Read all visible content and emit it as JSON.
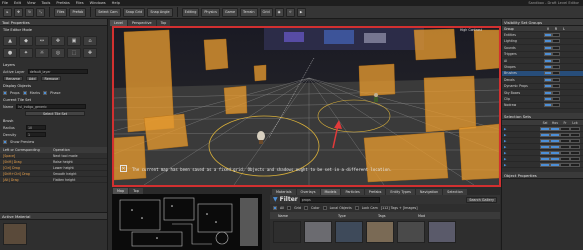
{
  "menubar": {
    "items": [
      "File",
      "Edit",
      "View",
      "Tools",
      "Prefabs",
      "Files",
      "Windows",
      "Help"
    ],
    "title": "Sandbox - Draft Level Editor"
  },
  "toolbar": {
    "labels": [
      "Files",
      "Prefab",
      "Select Cam",
      "Snap Grid",
      "Snap Angle",
      "Editing",
      "Physics",
      "Game",
      "Terrain",
      "Grid"
    ]
  },
  "leftpanel": {
    "title": "Tool Properties",
    "tool_title": "Tile Editor Mode",
    "tool_icons": [
      "▲",
      "◆",
      "↔",
      "✥",
      "▣",
      "⌂",
      "●",
      "✦",
      "☼",
      "◎",
      "⬚",
      "✚"
    ],
    "layers_label": "Layers",
    "active_layer_label": "Active Layer",
    "active_layer_value": "default_layer",
    "layer_buttons": [
      "Rename",
      "Add",
      "Remove"
    ],
    "display_label": "Display Objects",
    "display_opts": [
      "Props",
      "Marks",
      "Phase"
    ],
    "current_tile_label": "Current Tile Set",
    "name_label": "Name",
    "name_value": "lvl_indigo_generic",
    "select_btn": "Select Tile Set",
    "brush_label": "Brush",
    "radius_label": "Radius",
    "radius_value": "10",
    "density_label": "Density",
    "density_value": "1",
    "show_preview_label": "Show Preview",
    "shortcuts": {
      "col1": "Left or Corresponding",
      "col2": "Operation",
      "rows": [
        {
          "k": "[Space]",
          "v": "Next tool mode"
        },
        {
          "k": "[Shift] Drag",
          "v": "Raise height"
        },
        {
          "k": "[Ctrl] Drag",
          "v": "Lower height"
        },
        {
          "k": "[Shift+Ctrl] Drag",
          "v": "Smooth height"
        },
        {
          "k": "[Alt] Drag",
          "v": "Flatten height"
        }
      ]
    },
    "bottom_title": "Active Material"
  },
  "viewport": {
    "tabs": [
      "Level",
      "Perspective",
      "Top"
    ],
    "corner_label": "High Contrast",
    "hint_text": "The current map has been saved as a fixed grid. Objects and shadows ought to be set in a different location."
  },
  "minimap": {
    "tabs": [
      "Map",
      "Top"
    ]
  },
  "browser": {
    "tabs": [
      "Materials",
      "Overlays",
      "Models",
      "Particles",
      "Prefabs",
      "Entity Types",
      "Navigation",
      "Selection"
    ],
    "filter_title": "Filter",
    "search_value": "props",
    "opts": [
      "All",
      "Grid",
      "Color",
      "Local Objects",
      "Lock Cam",
      "Use Map"
    ],
    "count_label": "[112] Tags + [Images]",
    "search_btn": "Search Gallery",
    "columns": [
      "Name",
      "Type",
      "Tags",
      "Mod"
    ]
  },
  "rightpanel": {
    "title": "Visibility Set Groups",
    "group_header": [
      "Group",
      "V",
      "R",
      "L"
    ],
    "groups": [
      "Entities",
      "Lighting",
      "Sounds",
      "Triggers",
      "AI",
      "Shapes",
      "Brushes",
      "Decals",
      "Dynamic Props",
      "Sky Boxes",
      "Clip",
      "Nodraw"
    ],
    "selection_title": "Selection Sets",
    "sel_header": [
      "Sel",
      "Hov",
      "Fr",
      "Lck"
    ],
    "sel_rows": 7,
    "props_title": "Object Properties"
  },
  "colors": {
    "accent_red": "#d23030",
    "orange_blocks": "#e59a2f",
    "selection_blue": "#274d7a",
    "shortcut_key": "#e8a04a"
  }
}
